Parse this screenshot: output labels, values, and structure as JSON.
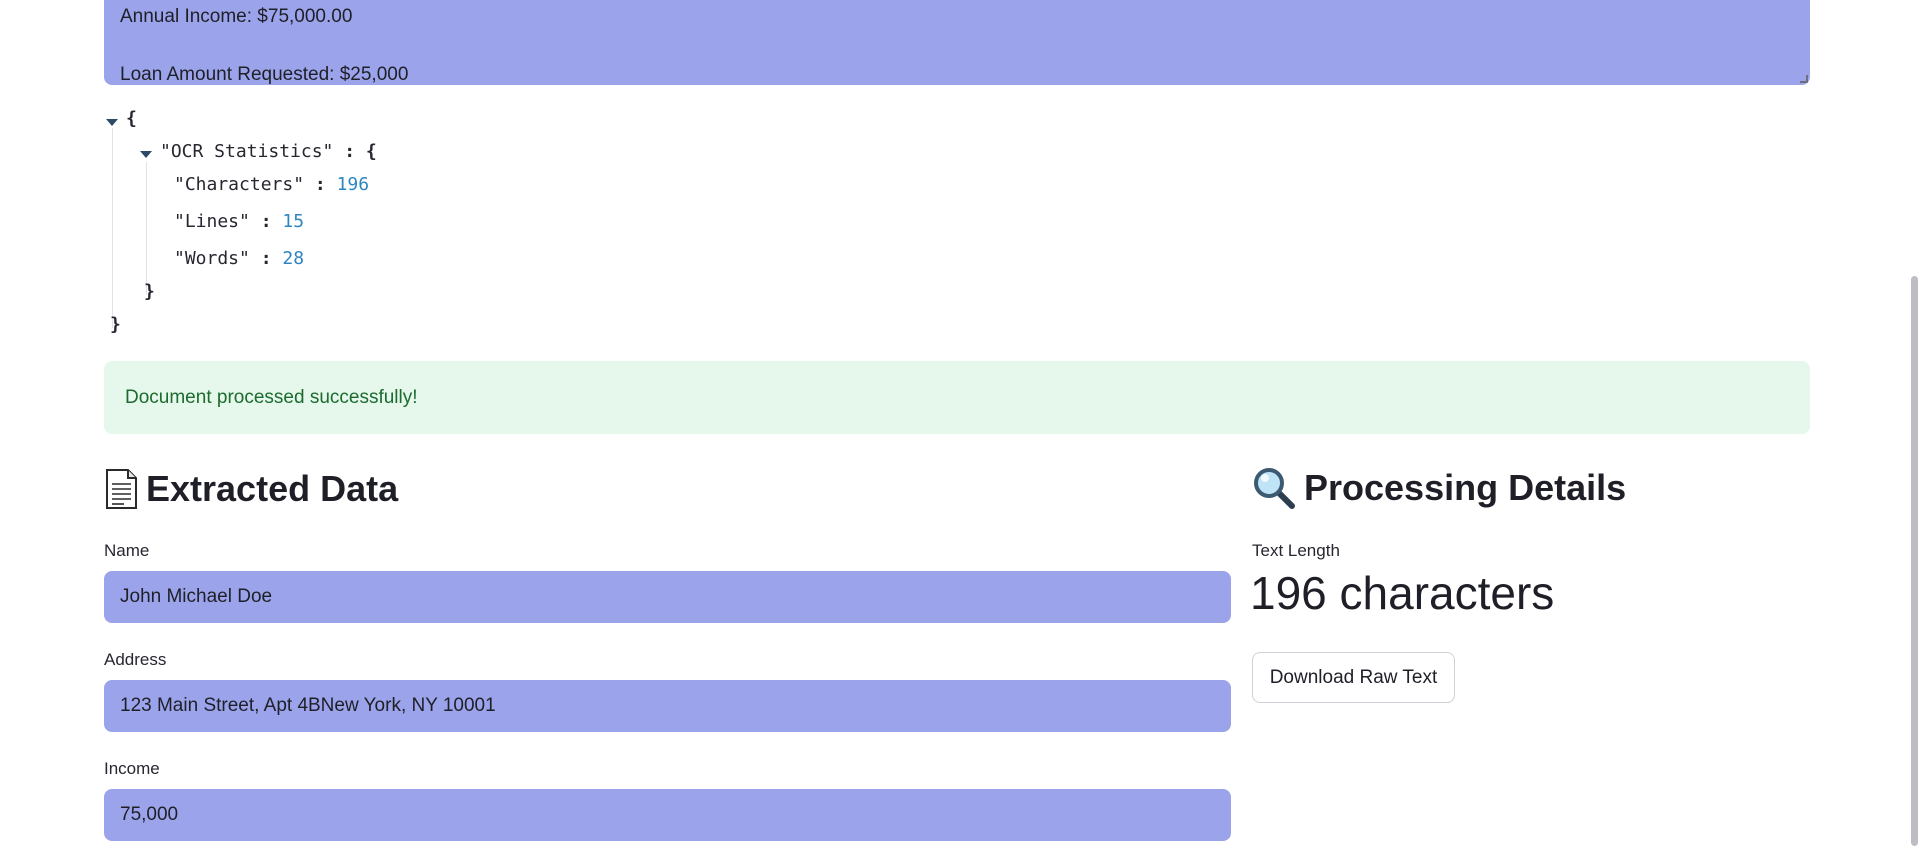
{
  "raw_text": {
    "lines": [
      "Annual Income: $75,000.00",
      "",
      "Loan Amount Requested: $25,000"
    ]
  },
  "json_viewer": {
    "open_brace": "{",
    "close_brace": "}",
    "ocr_key": "\"OCR Statistics\"",
    "colon": ":",
    "fields": [
      {
        "key": "\"Characters\"",
        "value": "196"
      },
      {
        "key": "\"Lines\"",
        "value": "15"
      },
      {
        "key": "\"Words\"",
        "value": "28"
      }
    ]
  },
  "alert": {
    "message": "Document processed successfully!"
  },
  "extracted": {
    "heading": "Extracted Data",
    "icon": "page-facing-up-icon",
    "fields": [
      {
        "label": "Name",
        "value": "John Michael Doe"
      },
      {
        "label": "Address",
        "value": "123 Main Street, Apt 4BNew York, NY 10001"
      },
      {
        "label": "Income",
        "value": "75,000"
      }
    ]
  },
  "processing": {
    "heading": "Processing Details",
    "icon": "magnifying-glass-icon",
    "metric_label": "Text Length",
    "metric_value": "196 characters",
    "download_label": "Download Raw Text"
  },
  "colors": {
    "input_bg": "#9ba4ea",
    "success_bg": "#e6f7ec",
    "success_text": "#1c6b2f",
    "json_number": "#2e86c1"
  }
}
